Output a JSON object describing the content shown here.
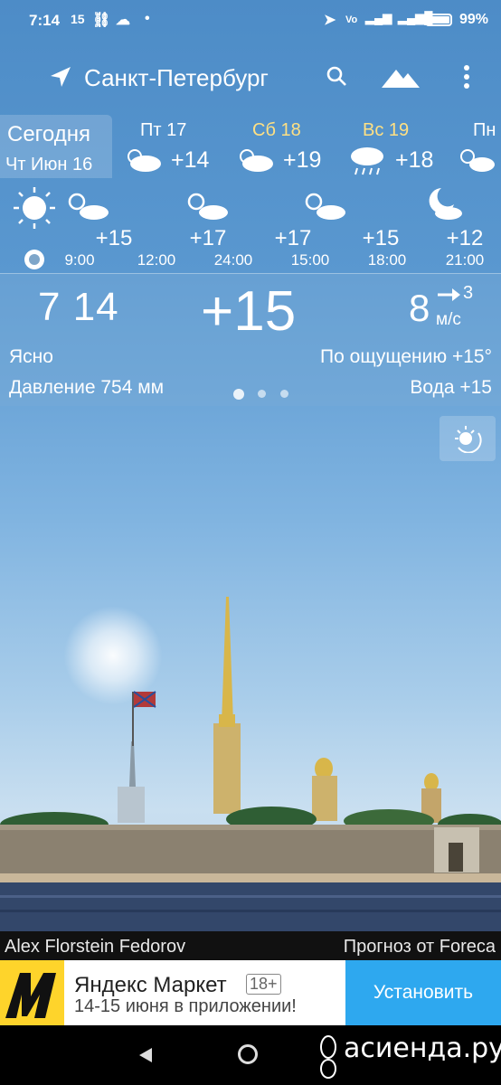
{
  "status_bar": {
    "time": "7:14",
    "extra": "15",
    "dot": "•",
    "battery": "99%"
  },
  "header": {
    "city": "Санкт-Петербург"
  },
  "days": {
    "today_label": "Сегодня",
    "today_date": "Чт Июн 16",
    "items": [
      {
        "name": "Пт 17",
        "temp": "+14",
        "icon": "cloudy-icon"
      },
      {
        "name": "Сб 18",
        "temp": "+19",
        "icon": "cloudy-icon"
      },
      {
        "name": "Вс 19",
        "temp": "+18",
        "icon": "rain-icon"
      },
      {
        "name": "Пн",
        "temp": "",
        "icon": "partly-cloudy-icon"
      }
    ]
  },
  "hourly": [
    {
      "time": "9:00",
      "temp": "+15",
      "icon": "partly-cloudy-icon"
    },
    {
      "time": "12:00",
      "temp": "+17",
      "icon": "partly-cloudy-icon"
    },
    {
      "time": "15:00",
      "temp": "+17",
      "icon": "partly-cloudy-icon"
    },
    {
      "time": "18:00",
      "temp": "+15",
      "icon": "partly-cloudy-icon"
    },
    {
      "time": "21:00",
      "temp": "+12",
      "icon": "moon-cloud-icon"
    },
    {
      "time": "24:00",
      "temp": "",
      "icon": ""
    }
  ],
  "current": {
    "time": "7 14",
    "temp": "+15",
    "wind_speed": "8",
    "wind_gust": "3",
    "wind_unit": "м/с",
    "condition": "Ясно",
    "feels_like": "По ощущению +15°",
    "pressure": "Давление 754 мм",
    "water": "Вода +15",
    "page_dots": 3
  },
  "credits": {
    "photo": "Alex Florstein Fedorov",
    "source": "Прогноз от Foreca"
  },
  "ad": {
    "title": "Яндекс Маркет",
    "badge": "18+",
    "subtitle": "14-15 июня в приложении!",
    "button": "Установить"
  },
  "watermark": "асиенда.ру"
}
